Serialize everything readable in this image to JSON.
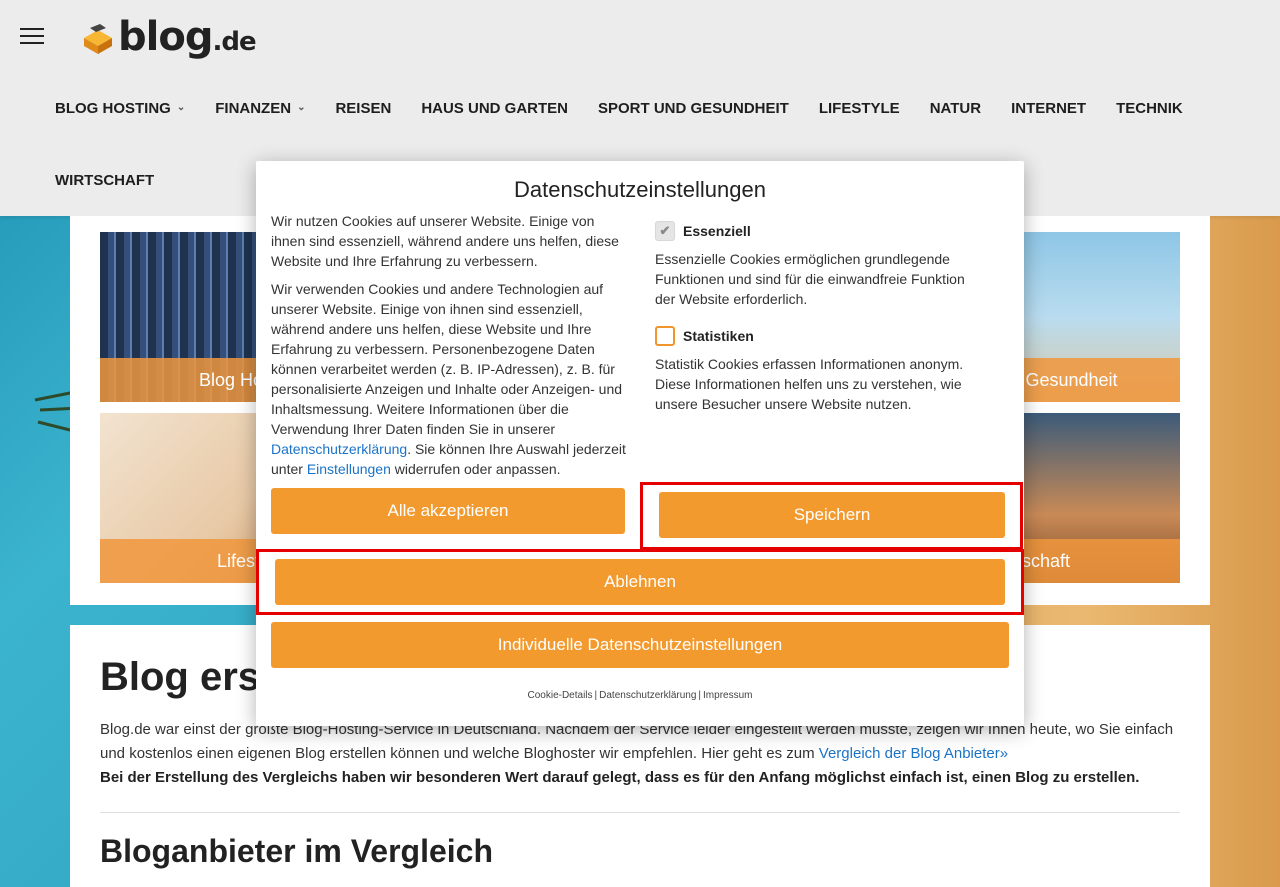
{
  "site": {
    "logo_text": "blog",
    "logo_tld": ".de"
  },
  "nav": {
    "items": [
      {
        "label": "BLOG HOSTING",
        "has_dropdown": true
      },
      {
        "label": "FINANZEN",
        "has_dropdown": true
      },
      {
        "label": "REISEN",
        "has_dropdown": false
      },
      {
        "label": "HAUS UND GARTEN",
        "has_dropdown": false
      },
      {
        "label": "SPORT UND GESUNDHEIT",
        "has_dropdown": false
      },
      {
        "label": "LIFESTYLE",
        "has_dropdown": false
      },
      {
        "label": "NATUR",
        "has_dropdown": false
      },
      {
        "label": "INTERNET",
        "has_dropdown": false
      },
      {
        "label": "TECHNIK",
        "has_dropdown": false
      },
      {
        "label": "WIRTSCHAFT",
        "has_dropdown": false
      }
    ]
  },
  "tiles": {
    "blog_hosting": "Blog Hosting",
    "sport": "Sport und Gesundheit",
    "lifestyle": "Lifestyle",
    "wirtschaft": "Wirtschaft"
  },
  "article": {
    "title": "Blog erstellen",
    "p1_text": "Blog.de war einst der größte Blog-Hosting-Service in Deutschland. Nachdem der Service leider eingestellt werden musste, zeigen wir Ihnen heute, wo Sie einfach und kostenlos einen eigenen Blog erstellen können und welche Bloghoster wir empfehlen. Hier geht es zum ",
    "p1_link": "Vergleich der Blog Anbieter»",
    "p2": "Bei der Erstellung des Vergleichs haben wir besonderen Wert darauf gelegt, dass es für den Anfang möglichst einfach ist, einen Blog zu erstellen.",
    "h2": "Bloganbieter im Vergleich"
  },
  "modal": {
    "title": "Datenschutzeinstellungen",
    "intro_p1": "Wir nutzen Cookies auf unserer Website. Einige von ihnen sind essenziell, während andere uns helfen, diese Website und Ihre Erfahrung zu verbessern.",
    "intro_p2_a": "Wir verwenden Cookies und andere Technologien auf unserer Website. Einige von ihnen sind essenziell, während andere uns helfen, diese Website und Ihre Erfahrung zu verbessern. Personenbezogene Daten können verarbeitet werden (z. B. IP-Adressen), z. B. für personalisierte Anzeigen und Inhalte oder Anzeigen- und Inhaltsmessung. Weitere Informationen über die Verwendung Ihrer Daten finden Sie in unserer ",
    "intro_link1": "Datenschutzerklärung",
    "intro_p2_b": ". Sie können Ihre Auswahl jederzeit unter ",
    "intro_link2": "Einstellungen",
    "intro_p2_c": " widerrufen oder anpassen.",
    "categories": [
      {
        "name": "Essenziell",
        "checked": true,
        "desc": "Essenzielle Cookies ermöglichen grundlegende Funktionen und sind für die einwandfreie Funktion der Website erforderlich."
      },
      {
        "name": "Statistiken",
        "checked": false,
        "desc": "Statistik Cookies erfassen Informationen anonym. Diese Informationen helfen uns zu verstehen, wie unsere Besucher unsere Website nutzen."
      }
    ],
    "btn_accept_all": "Alle akzeptieren",
    "btn_save": "Speichern",
    "btn_reject": "Ablehnen",
    "btn_individual": "Individuelle Datenschutzeinstellungen",
    "footer_links": [
      "Cookie-Details",
      "Datenschutzerklärung",
      "Impressum"
    ]
  },
  "colors": {
    "accent": "#f39a2e",
    "link": "#1a73c7",
    "highlight": "#e50000"
  }
}
